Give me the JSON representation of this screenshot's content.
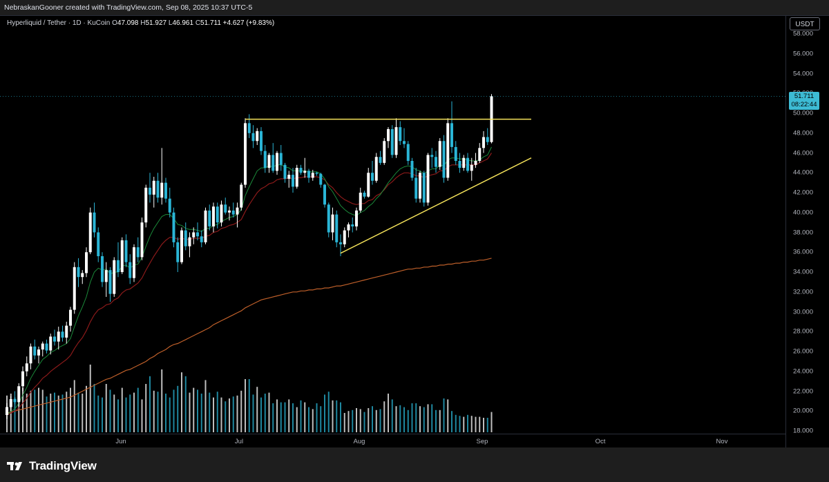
{
  "attribution": "NebraskanGooner created with TradingView.com, Sep 08, 2025 10:37 UTC-5",
  "legend": {
    "symbol": "Hyperliquid / Tether · 1D · KuCoin",
    "open_label": "O",
    "open": "47.098",
    "high_label": "H",
    "high": "51.927",
    "low_label": "L",
    "low": "46.961",
    "close_label": "C",
    "close": "51.711",
    "change": "+4.627 (+9.83%)"
  },
  "currency": "USDT",
  "price_tag": {
    "price": "51.711",
    "countdown": "08:22:44"
  },
  "brand": {
    "name": "TradingView",
    "icon": "tradingview-logo-icon"
  },
  "colors": {
    "up": "#ffffff",
    "down": "#2ab5d6",
    "ema_short": "#1b8a3a",
    "ema_mid": "#8b1a1a",
    "ema_long": "#c0602a",
    "trendline": "#f5e35a",
    "background": "#000000"
  },
  "chart_data": {
    "type": "candlestick",
    "x_ticks": [
      "Jun",
      "Jul",
      "Aug",
      "Sep",
      "Oct",
      "Nov"
    ],
    "y_ticks": [
      "18.000",
      "20.000",
      "22.000",
      "24.000",
      "26.000",
      "28.000",
      "30.000",
      "32.000",
      "34.000",
      "36.000",
      "38.000",
      "40.000",
      "42.000",
      "44.000",
      "46.000",
      "48.000",
      "50.000",
      "52.000",
      "54.000",
      "56.000",
      "58.000"
    ],
    "ylim": [
      18,
      58
    ],
    "ohlc": [
      [
        19.6,
        20.8,
        19.2,
        20.4
      ],
      [
        20.4,
        21.5,
        20.0,
        21.2
      ],
      [
        21.2,
        22.0,
        20.7,
        20.9
      ],
      [
        20.9,
        22.8,
        20.5,
        22.5
      ],
      [
        22.5,
        24.5,
        22.0,
        24.0
      ],
      [
        24.0,
        25.5,
        23.5,
        24.8
      ],
      [
        24.8,
        26.8,
        24.2,
        26.5
      ],
      [
        26.5,
        27.2,
        25.2,
        25.6
      ],
      [
        25.6,
        26.5,
        24.8,
        26.2
      ],
      [
        26.2,
        27.0,
        25.5,
        26.8
      ],
      [
        26.8,
        27.2,
        25.8,
        26.1
      ],
      [
        26.1,
        27.8,
        25.7,
        27.5
      ],
      [
        27.5,
        28.2,
        26.6,
        27.0
      ],
      [
        27.0,
        28.5,
        26.2,
        28.0
      ],
      [
        28.0,
        28.6,
        27.0,
        27.4
      ],
      [
        27.4,
        29.0,
        26.8,
        28.6
      ],
      [
        28.6,
        30.5,
        28.0,
        30.2
      ],
      [
        30.2,
        35.0,
        29.8,
        34.5
      ],
      [
        34.5,
        35.4,
        32.5,
        33.5
      ],
      [
        33.5,
        34.2,
        32.8,
        33.9
      ],
      [
        33.9,
        36.5,
        33.5,
        36.0
      ],
      [
        36.0,
        40.5,
        35.8,
        40.0
      ],
      [
        40.0,
        41.0,
        37.5,
        38.0
      ],
      [
        38.0,
        38.5,
        35.0,
        35.6
      ],
      [
        35.6,
        36.0,
        32.5,
        33.0
      ],
      [
        33.0,
        35.0,
        31.5,
        34.2
      ],
      [
        34.2,
        34.5,
        31.0,
        31.8
      ],
      [
        31.8,
        35.5,
        31.5,
        35.2
      ],
      [
        35.2,
        37.0,
        33.5,
        34.0
      ],
      [
        34.0,
        37.5,
        33.8,
        37.2
      ],
      [
        37.2,
        37.8,
        34.5,
        35.0
      ],
      [
        35.0,
        35.8,
        32.8,
        33.4
      ],
      [
        33.4,
        36.8,
        33.0,
        36.5
      ],
      [
        36.5,
        37.5,
        35.0,
        35.5
      ],
      [
        35.5,
        39.5,
        35.2,
        39.0
      ],
      [
        39.0,
        42.8,
        38.5,
        42.5
      ],
      [
        42.5,
        44.0,
        41.0,
        41.8
      ],
      [
        41.8,
        43.6,
        40.5,
        43.2
      ],
      [
        43.2,
        44.0,
        41.0,
        41.5
      ],
      [
        41.5,
        46.5,
        40.8,
        43.0
      ],
      [
        43.0,
        43.5,
        41.0,
        41.4
      ],
      [
        41.4,
        42.5,
        39.5,
        40.0
      ],
      [
        40.0,
        40.5,
        36.5,
        37.0
      ],
      [
        37.0,
        37.5,
        34.0,
        35.0
      ],
      [
        35.0,
        38.5,
        34.8,
        38.2
      ],
      [
        38.2,
        39.0,
        36.2,
        36.6
      ],
      [
        36.6,
        38.0,
        35.5,
        37.5
      ],
      [
        37.5,
        38.5,
        36.8,
        38.0
      ],
      [
        38.0,
        39.0,
        37.2,
        37.6
      ],
      [
        37.6,
        38.2,
        36.5,
        37.0
      ],
      [
        37.0,
        40.5,
        36.8,
        40.2
      ],
      [
        40.2,
        40.8,
        38.2,
        38.6
      ],
      [
        38.6,
        41.0,
        38.0,
        40.6
      ],
      [
        40.6,
        41.0,
        38.4,
        39.0
      ],
      [
        39.0,
        41.2,
        38.6,
        40.8
      ],
      [
        40.8,
        41.5,
        39.8,
        40.0
      ],
      [
        40.0,
        40.6,
        39.2,
        40.2
      ],
      [
        40.2,
        41.0,
        39.5,
        39.8
      ],
      [
        39.8,
        41.0,
        38.5,
        40.5
      ],
      [
        40.5,
        43.0,
        40.2,
        42.8
      ],
      [
        42.8,
        49.5,
        42.5,
        49.0
      ],
      [
        49.0,
        49.9,
        47.5,
        48.0
      ],
      [
        48.0,
        48.8,
        46.5,
        47.2
      ],
      [
        47.2,
        48.5,
        46.8,
        48.2
      ],
      [
        48.2,
        48.6,
        45.8,
        46.2
      ],
      [
        46.2,
        46.8,
        44.0,
        44.5
      ],
      [
        44.5,
        46.0,
        44.0,
        45.8
      ],
      [
        45.8,
        47.0,
        44.0,
        44.2
      ],
      [
        44.2,
        46.2,
        43.8,
        46.0
      ],
      [
        46.0,
        46.8,
        44.2,
        44.8
      ],
      [
        44.8,
        45.0,
        43.0,
        43.4
      ],
      [
        43.4,
        44.2,
        42.5,
        43.8
      ],
      [
        43.8,
        44.5,
        42.0,
        42.6
      ],
      [
        42.6,
        44.8,
        42.4,
        44.5
      ],
      [
        44.5,
        44.8,
        43.8,
        44.0
      ],
      [
        44.0,
        45.5,
        43.5,
        44.2
      ],
      [
        44.2,
        44.4,
        43.0,
        43.5
      ],
      [
        43.5,
        44.3,
        43.2,
        44.0
      ],
      [
        44.0,
        44.1,
        43.7,
        43.9
      ],
      [
        43.9,
        44.0,
        42.5,
        42.8
      ],
      [
        42.8,
        42.9,
        40.5,
        40.8
      ],
      [
        40.8,
        41.0,
        37.5,
        38.0
      ],
      [
        38.0,
        40.5,
        37.2,
        39.8
      ],
      [
        39.8,
        40.2,
        36.5,
        37.0
      ],
      [
        37.0,
        37.8,
        35.6,
        36.8
      ],
      [
        36.8,
        38.5,
        36.5,
        38.2
      ],
      [
        38.2,
        39.0,
        37.5,
        38.8
      ],
      [
        38.8,
        39.5,
        38.0,
        38.6
      ],
      [
        38.6,
        40.5,
        38.2,
        40.2
      ],
      [
        40.2,
        42.5,
        40.0,
        42.0
      ],
      [
        42.0,
        42.2,
        41.4,
        41.6
      ],
      [
        41.6,
        44.5,
        41.5,
        44.0
      ],
      [
        44.0,
        45.2,
        42.8,
        43.2
      ],
      [
        43.2,
        46.0,
        43.0,
        45.6
      ],
      [
        45.6,
        46.2,
        44.8,
        45.0
      ],
      [
        45.0,
        47.5,
        44.8,
        47.2
      ],
      [
        47.2,
        48.6,
        46.5,
        48.4
      ],
      [
        48.4,
        48.8,
        45.5,
        45.8
      ],
      [
        45.8,
        49.5,
        45.5,
        48.6
      ],
      [
        48.6,
        49.2,
        46.8,
        47.2
      ],
      [
        47.2,
        48.5,
        46.5,
        46.9
      ],
      [
        46.9,
        47.2,
        44.8,
        45.2
      ],
      [
        45.2,
        45.5,
        43.2,
        43.5
      ],
      [
        43.5,
        44.5,
        41.0,
        41.4
      ],
      [
        41.4,
        44.2,
        41.0,
        44.0
      ],
      [
        44.0,
        44.2,
        40.6,
        41.0
      ],
      [
        41.0,
        46.0,
        40.7,
        45.8
      ],
      [
        45.8,
        46.5,
        44.5,
        45.6
      ],
      [
        45.6,
        46.2,
        44.0,
        44.6
      ],
      [
        44.6,
        47.5,
        44.3,
        47.2
      ],
      [
        47.2,
        47.8,
        43.0,
        43.5
      ],
      [
        43.5,
        49.5,
        43.2,
        49.0
      ],
      [
        49.0,
        51.2,
        46.0,
        46.6
      ],
      [
        46.6,
        47.2,
        44.8,
        45.2
      ],
      [
        45.2,
        46.0,
        44.0,
        44.5
      ],
      [
        44.5,
        45.8,
        44.2,
        45.5
      ],
      [
        45.5,
        46.0,
        44.0,
        44.2
      ],
      [
        44.2,
        45.5,
        43.2,
        44.8
      ],
      [
        44.8,
        46.0,
        44.5,
        45.2
      ],
      [
        45.2,
        47.0,
        45.0,
        46.5
      ],
      [
        46.5,
        48.2,
        46.0,
        47.6
      ],
      [
        47.6,
        48.5,
        46.8,
        47.1
      ],
      [
        47.098,
        51.927,
        46.961,
        51.711
      ]
    ],
    "volume": [
      3.8,
      4.0,
      3.6,
      4.4,
      4.6,
      4.0,
      4.3,
      4.4,
      4.6,
      4.4,
      3.7,
      4.0,
      4.1,
      3.8,
      3.9,
      4.2,
      4.6,
      5.4,
      4.1,
      4.0,
      4.8,
      7.0,
      5.0,
      3.8,
      3.6,
      5.0,
      4.4,
      3.9,
      3.4,
      4.6,
      3.6,
      3.9,
      4.1,
      4.6,
      3.4,
      5.0,
      5.8,
      4.3,
      4.2,
      6.5,
      4.0,
      3.6,
      4.4,
      4.8,
      6.2,
      5.8,
      4.1,
      4.6,
      4.4,
      4.0,
      5.4,
      4.1,
      3.6,
      4.2,
      3.6,
      3.2,
      3.5,
      3.7,
      3.8,
      4.3,
      5.5,
      5.5,
      3.9,
      4.7,
      3.6,
      4.0,
      4.1,
      3.0,
      3.4,
      3.1,
      3.1,
      3.4,
      3.0,
      2.6,
      3.3,
      3.1,
      2.6,
      2.4,
      3.0,
      2.7,
      3.9,
      4.2,
      3.3,
      3.3,
      3.1,
      2.0,
      2.2,
      2.3,
      2.5,
      2.4,
      2.1,
      2.5,
      2.7,
      2.3,
      2.4,
      3.2,
      4.0,
      3.4,
      2.7,
      2.8,
      2.6,
      2.3,
      3.0,
      3.0,
      2.7,
      2.6,
      2.9,
      2.9,
      2.3,
      2.3,
      3.5,
      3.4,
      2.2,
      1.8,
      1.7,
      1.6,
      1.8,
      1.7,
      1.6,
      1.6,
      1.5,
      1.5,
      2.1
    ],
    "ema_short": [
      19.6,
      20.0,
      20.2,
      20.8,
      21.6,
      22.4,
      23.3,
      24.0,
      24.6,
      25.2,
      25.5,
      25.9,
      26.1,
      26.4,
      26.6,
      26.8,
      27.3,
      28.5,
      29.6,
      30.5,
      31.5,
      33.0,
      34.0,
      34.4,
      34.2,
      34.3,
      33.8,
      34.0,
      34.0,
      34.6,
      34.7,
      34.4,
      34.7,
      34.8,
      35.5,
      36.6,
      37.6,
      38.4,
      39.0,
      39.6,
      39.8,
      39.8,
      39.4,
      38.8,
      38.7,
      38.4,
      38.3,
      38.3,
      38.2,
      38.1,
      38.4,
      38.4,
      38.7,
      38.8,
      39.1,
      39.3,
      39.5,
      39.6,
      39.8,
      40.3,
      41.7,
      42.6,
      43.4,
      44.2,
      44.5,
      44.5,
      44.7,
      44.6,
      44.8,
      44.8,
      44.6,
      44.5,
      44.2,
      44.2,
      44.2,
      44.2,
      44.1,
      44.1,
      44.1,
      43.9,
      43.4,
      42.6,
      42.1,
      41.4,
      40.7,
      40.3,
      40.0,
      39.8,
      39.7,
      40.0,
      40.2,
      40.6,
      40.9,
      41.4,
      41.8,
      42.4,
      43.0,
      43.5,
      44.0,
      44.4,
      44.6,
      44.7,
      44.6,
      44.3,
      44.2,
      43.9,
      44.2,
      44.4,
      44.4,
      44.8,
      44.7,
      45.3,
      45.5,
      45.5,
      45.4,
      45.4,
      45.3,
      45.2,
      45.2,
      45.3,
      45.6,
      45.8,
      46.6
    ],
    "ema_mid": [
      19.6,
      19.8,
      20.0,
      20.3,
      20.8,
      21.3,
      21.9,
      22.4,
      22.8,
      23.3,
      23.6,
      24.0,
      24.3,
      24.6,
      24.9,
      25.2,
      25.6,
      26.3,
      26.9,
      27.4,
      28.1,
      29.0,
      29.7,
      30.2,
      30.4,
      30.7,
      30.8,
      31.2,
      31.4,
      31.9,
      32.2,
      32.3,
      32.6,
      32.9,
      33.4,
      34.2,
      34.9,
      35.6,
      36.2,
      36.8,
      37.2,
      37.5,
      37.5,
      37.3,
      37.4,
      37.3,
      37.3,
      37.4,
      37.4,
      37.4,
      37.6,
      37.7,
      38.0,
      38.1,
      38.4,
      38.5,
      38.7,
      38.8,
      39.0,
      39.3,
      40.1,
      40.8,
      41.4,
      42.0,
      42.4,
      42.6,
      42.9,
      43.0,
      43.3,
      43.4,
      43.4,
      43.5,
      43.4,
      43.5,
      43.5,
      43.6,
      43.6,
      43.6,
      43.6,
      43.5,
      43.3,
      42.8,
      42.5,
      42.0,
      41.6,
      41.3,
      41.1,
      40.9,
      40.8,
      40.9,
      40.9,
      41.2,
      41.3,
      41.7,
      41.9,
      42.3,
      42.8,
      43.1,
      43.5,
      43.8,
      44.0,
      44.0,
      43.9,
      43.7,
      43.7,
      43.5,
      43.7,
      43.8,
      43.9,
      44.2,
      44.2,
      44.6,
      44.8,
      44.8,
      44.8,
      44.8,
      44.8,
      44.8,
      44.8,
      45.0,
      45.2,
      45.4,
      46.0
    ],
    "ema_long": [
      19.8,
      19.9,
      20.0,
      20.1,
      20.2,
      20.3,
      20.4,
      20.5,
      20.6,
      20.7,
      20.8,
      20.9,
      21.0,
      21.1,
      21.2,
      21.3,
      21.4,
      21.6,
      21.8,
      22.0,
      22.2,
      22.4,
      22.6,
      22.8,
      23.0,
      23.2,
      23.3,
      23.5,
      23.7,
      23.9,
      24.1,
      24.2,
      24.4,
      24.6,
      24.8,
      25.0,
      25.3,
      25.5,
      25.8,
      26.0,
      26.2,
      26.5,
      26.7,
      26.8,
      27.0,
      27.2,
      27.4,
      27.6,
      27.8,
      28.0,
      28.2,
      28.4,
      28.7,
      28.9,
      29.1,
      29.3,
      29.5,
      29.7,
      29.9,
      30.1,
      30.4,
      30.6,
      30.8,
      31.0,
      31.2,
      31.3,
      31.4,
      31.5,
      31.6,
      31.7,
      31.8,
      31.9,
      32.0,
      32.0,
      32.1,
      32.1,
      32.2,
      32.2,
      32.3,
      32.3,
      32.4,
      32.4,
      32.5,
      32.6,
      32.6,
      32.7,
      32.8,
      32.9,
      33.0,
      33.1,
      33.2,
      33.3,
      33.4,
      33.5,
      33.6,
      33.7,
      33.8,
      33.9,
      34.0,
      34.1,
      34.2,
      34.3,
      34.3,
      34.4,
      34.4,
      34.5,
      34.5,
      34.6,
      34.6,
      34.7,
      34.7,
      34.8,
      34.8,
      34.9,
      34.9,
      35.0,
      35.0,
      35.1,
      35.1,
      35.2,
      35.2,
      35.3,
      35.4
    ],
    "trendlines": [
      {
        "name": "resistance",
        "x1": 60,
        "y1": 49.4,
        "x2": 132,
        "y2": 49.4
      },
      {
        "name": "rising-support",
        "x1": 84,
        "y1": 35.9,
        "x2": 132,
        "y2": 45.5
      }
    ]
  }
}
